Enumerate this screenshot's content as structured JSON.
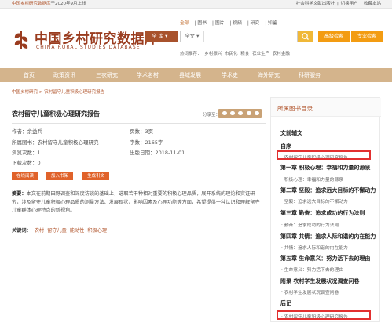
{
  "topbar": {
    "site_name": "中国乡村研究数据库",
    "since_text": "于2020年9月上线",
    "links": [
      "社会科学文献出版社",
      "切换用户",
      "收藏本站"
    ]
  },
  "header": {
    "logo_cn": "中国乡村研究数据库",
    "logo_en": "CHINA RURAL STUDIES DATABASE",
    "search_tabs": [
      "全部",
      "图书",
      "图片",
      "视频",
      "研究",
      "知鉴"
    ],
    "search_select": "全 库",
    "search_scope": "全文",
    "search_placeholder": "",
    "advanced_search": "高级检索",
    "pro_search": "专业检索",
    "hot_label": "热词推荐：",
    "hot_words": [
      "乡村振兴",
      "市民化",
      "粮食",
      "农业生产",
      "农村金融"
    ]
  },
  "nav": [
    "首页",
    "政策资讯",
    "三农研究",
    "学术名村",
    "县域发展",
    "学术史",
    "海外研究",
    "科研服务"
  ],
  "breadcrumb": "中国乡村研究 > 农村留守儿童积极心理研究报告",
  "book": {
    "title": "农村留守儿童积极心理研究报告",
    "share": "分享至：",
    "author": "作者：余益兵",
    "belong": "所属图书：农村留守儿童积极心理研究",
    "views": "浏览次数：1",
    "downloads": "下载次数：0",
    "pages": "页数：3页",
    "words": "字数：2165字",
    "date": "出版日期：2018-11-01",
    "btn_read": "在线阅读",
    "btn_shelf": "加入书架",
    "btn_cite": "生成引文",
    "abstract_label": "摘要：",
    "abstract": "本文在前期田野调查和深度访谈的基础上，选取若干种相对重要的积极心理品质，展开系统的理论和实证研究，涉及留守儿童积极心理品质的测量方法、发展现状、影响因素及心理功能等方面，希望提供一种认识和理解留守儿童群体心理特点的新视角。",
    "keywords_label": "关键词：",
    "keywords": [
      "农村",
      "留守儿童",
      "能动性",
      "积极心理"
    ]
  },
  "toc": {
    "heading": "所属图书目录",
    "items": [
      {
        "type": "h",
        "text": "文前辅文"
      },
      {
        "type": "h",
        "text": "自序"
      },
      {
        "type": "s",
        "text": "农村留守儿童积极心理研究报告"
      },
      {
        "type": "h",
        "text": "第一章 积极心理：幸福和力量的源泉"
      },
      {
        "type": "s",
        "text": "积极心理：幸福和力量的源泉"
      },
      {
        "type": "h",
        "text": "第二章 坚毅：追求远大目标的不懈动力"
      },
      {
        "type": "s",
        "text": "坚毅：追求远大目标的不懈动力"
      },
      {
        "type": "h",
        "text": "第三章 勤奋：追求成功的行为法则"
      },
      {
        "type": "s",
        "text": "勤奋：追求成功的行为法则"
      },
      {
        "type": "h",
        "text": "第四章 共情：追求人际和谐的内在能力"
      },
      {
        "type": "s",
        "text": "共情：追求人际和谐的内在能力"
      },
      {
        "type": "h",
        "text": "第五章 生命意义：努力活下去的理由"
      },
      {
        "type": "s",
        "text": "生命意义：努力活下去的理由"
      },
      {
        "type": "h",
        "text": "附录 农村学生发展状况调查问卷"
      },
      {
        "type": "s",
        "text": "农村学生发展状况调查问卷"
      },
      {
        "type": "h",
        "text": "后记"
      },
      {
        "type": "s",
        "text": "农村留守儿童积极心理研究报告"
      }
    ]
  },
  "colors": {
    "brand": "#9a3c1f",
    "nav_bg": "#d4b48c",
    "button": "#e0622a",
    "highlight": "#e23030",
    "search_btn": "#f39c12"
  }
}
